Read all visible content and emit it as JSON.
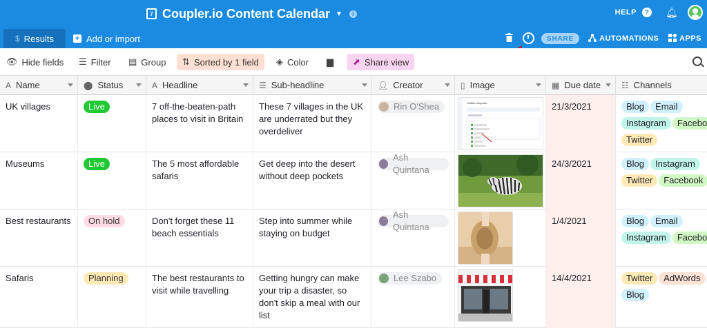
{
  "app": {
    "title": "Coupler.io Content Calendar",
    "calendar_icon_text": "7",
    "help_label": "HELP",
    "icons": [
      "calendar-icon",
      "chevron-down-icon",
      "info-icon",
      "help-icon",
      "bell-icon",
      "avatar",
      "trash-icon",
      "history-icon",
      "automations-icon",
      "apps-icon",
      "search-icon"
    ]
  },
  "tabs": {
    "results_label": "Results",
    "add_label": "Add or import"
  },
  "actions": {
    "share_label": "SHARE",
    "automations_label": "AUTOMATIONS",
    "apps_label": "APPS"
  },
  "toolbar": {
    "hide_fields": "Hide fields",
    "filter": "Filter",
    "group": "Group",
    "sorted": "Sorted by 1 field",
    "color": "Color",
    "share_view": "Share view"
  },
  "columns": {
    "name": "Name",
    "status": "Status",
    "headline": "Headline",
    "subheadline": "Sub-headline",
    "creator": "Creator",
    "image": "Image",
    "due": "Due date",
    "channels": "Channels"
  },
  "colors": {
    "header_blue": "#1a8be0",
    "live": "#20c933",
    "on_hold": "#ffdce5",
    "planning": "#ffeab6",
    "arrow": "#d9141b"
  },
  "rows": [
    {
      "name": "UK villages",
      "status": "Live",
      "headline": "7 off-the-beaten-path places to visit in Britain",
      "subheadline": "These 7 villages in the UK are underrated but they overdeliver",
      "creator": "Rin O'Shea",
      "due": "21/3/2021",
      "channels": [
        "Blog",
        "Email",
        "Instagram",
        "Facebook",
        "Twitter"
      ],
      "thumb_title": "Untitled Importer"
    },
    {
      "name": "Museums",
      "status": "Live",
      "headline": "The 5 most affordable safaris",
      "subheadline": "Get deep into the desert without deep pockets",
      "creator": "Ash Quintana",
      "due": "24/3/2021",
      "channels": [
        "Blog",
        "Instagram",
        "Twitter",
        "Facebook"
      ]
    },
    {
      "name": "Best restaurants",
      "status": "On hold",
      "headline": "Don't forget these 11 beach essentials",
      "subheadline": "Step into summer while staying on budget",
      "creator": "Ash Quintana",
      "due": "1/4/2021",
      "channels": [
        "Blog",
        "Email",
        "Instagram",
        "Facebook"
      ]
    },
    {
      "name": "Safaris",
      "status": "Planning",
      "headline": "The best restaurants to visit while travelling",
      "subheadline": "Getting hungry can make your trip a disaster, so don't skip a meal with our list",
      "creator": "Lee Szabo",
      "due": "14/4/2021",
      "channels": [
        "Twitter",
        "AdWords",
        "Blog"
      ]
    }
  ]
}
